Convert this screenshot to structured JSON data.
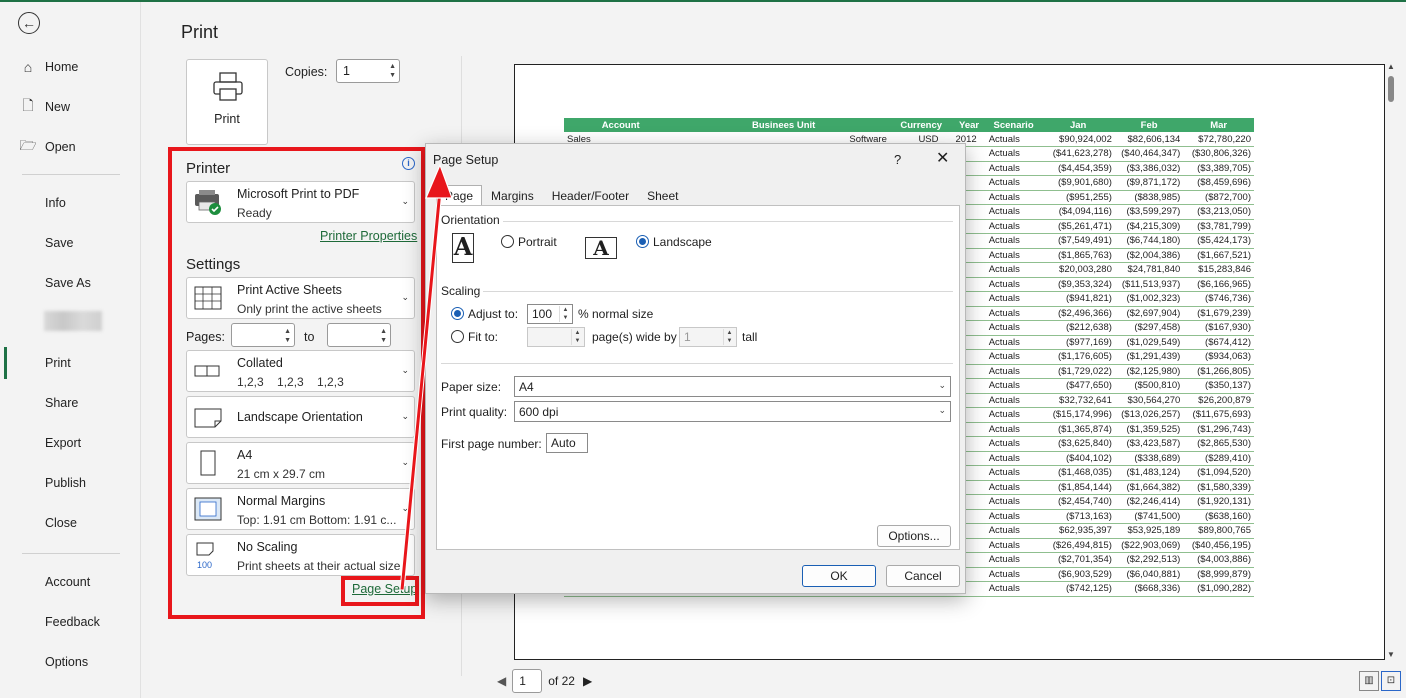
{
  "backstage": {
    "nav_top": [
      "Home",
      "New",
      "Open"
    ],
    "nav_mid": [
      "Info",
      "Save",
      "Save As",
      "Print",
      "Share",
      "Export",
      "Publish",
      "Close"
    ],
    "nav_bottom": [
      "Account",
      "Feedback",
      "Options"
    ],
    "active": "Print"
  },
  "print_panel": {
    "title": "Print",
    "print_button": "Print",
    "copies_label": "Copies:",
    "copies_value": "1",
    "printer_header": "Printer",
    "printer_name": "Microsoft Print to PDF",
    "printer_status": "Ready",
    "printer_properties": "Printer Properties",
    "settings_header": "Settings",
    "settings": [
      {
        "line1": "Print Active Sheets",
        "line2": "Only print the active sheets"
      },
      {
        "line1": "Collated",
        "line2": "1,2,3    1,2,3    1,2,3"
      },
      {
        "line1": "Landscape Orientation",
        "line2": ""
      },
      {
        "line1": "A4",
        "line2": "21 cm x 29.7 cm"
      },
      {
        "line1": "Normal Margins",
        "line2": "Top: 1.91 cm Bottom: 1.91 c..."
      },
      {
        "line1": "No Scaling",
        "line2": "Print sheets at their actual size"
      }
    ],
    "pages_label": "Pages:",
    "to_label": "to",
    "page_setup_link": "Page Setup",
    "no_scaling_badge": "100"
  },
  "preview": {
    "current_page": "1",
    "of_label": "of 22",
    "headers": [
      "Account",
      "Businees Unit",
      "Currency",
      "Year",
      "Scenario",
      "Jan",
      "Feb",
      "Mar"
    ],
    "first_row": [
      "Sales",
      "Software",
      "USD",
      "2012",
      "Actuals",
      "$90,924,002",
      "$82,606,134",
      "$72,780,220"
    ],
    "rows": [
      [
        "($41,623,278)",
        "($40,464,347)",
        "($30,806,326)"
      ],
      [
        "($4,454,359)",
        "($3,386,032)",
        "($3,389,705)"
      ],
      [
        "($9,901,680)",
        "($9,871,172)",
        "($8,459,696)"
      ],
      [
        "($951,255)",
        "($838,985)",
        "($872,700)"
      ],
      [
        "($4,094,116)",
        "($3,599,297)",
        "($3,213,050)"
      ],
      [
        "($5,261,471)",
        "($4,215,309)",
        "($3,781,799)"
      ],
      [
        "($7,549,491)",
        "($6,744,180)",
        "($5,424,173)"
      ],
      [
        "($1,865,763)",
        "($2,004,386)",
        "($1,667,521)"
      ],
      [
        "$20,003,280",
        "$24,781,840",
        "$15,283,846"
      ],
      [
        "($9,353,324)",
        "($11,513,937)",
        "($6,166,965)"
      ],
      [
        "($941,821)",
        "($1,002,323)",
        "($746,736)"
      ],
      [
        "($2,496,366)",
        "($2,697,904)",
        "($1,679,239)"
      ],
      [
        "($212,638)",
        "($297,458)",
        "($167,930)"
      ],
      [
        "($977,169)",
        "($1,029,549)",
        "($674,412)"
      ],
      [
        "($1,176,605)",
        "($1,291,439)",
        "($934,063)"
      ],
      [
        "($1,729,022)",
        "($2,125,980)",
        "($1,266,805)"
      ],
      [
        "($477,650)",
        "($500,810)",
        "($350,137)"
      ],
      [
        "$32,732,641",
        "$30,564,270",
        "$26,200,879"
      ],
      [
        "($15,174,996)",
        "($13,026,257)",
        "($11,675,693)"
      ],
      [
        "($1,365,874)",
        "($1,359,525)",
        "($1,296,743)"
      ],
      [
        "($3,625,840)",
        "($3,423,587)",
        "($2,865,530)"
      ],
      [
        "($404,102)",
        "($338,689)",
        "($289,410)"
      ],
      [
        "($1,468,035)",
        "($1,483,124)",
        "($1,094,520)"
      ],
      [
        "($1,854,144)",
        "($1,664,382)",
        "($1,580,339)"
      ],
      [
        "($2,454,740)",
        "($2,246,414)",
        "($1,920,131)"
      ],
      [
        "($713,163)",
        "($741,500)",
        "($638,160)"
      ],
      [
        "$62,935,397",
        "$53,925,189",
        "$89,800,765"
      ],
      [
        "($26,494,815)",
        "($22,903,069)",
        "($40,456,195)"
      ],
      [
        "($2,701,354)",
        "($2,292,513)",
        "($4,003,886)"
      ],
      [
        "($6,903,529)",
        "($6,040,881)",
        "($8,999,879)"
      ],
      [
        "($742,125)",
        "($668,336)",
        "($1,090,282)"
      ]
    ],
    "scenario": "Actuals"
  },
  "dialog": {
    "title": "Page Setup",
    "help": "?",
    "close": "✕",
    "tabs": [
      "Page",
      "Margins",
      "Header/Footer",
      "Sheet"
    ],
    "orientation_label": "Orientation",
    "portrait": "Portrait",
    "landscape": "Landscape",
    "scaling_label": "Scaling",
    "adjust_to": "Adjust to:",
    "adjust_value": "100",
    "normal_size": "% normal size",
    "fit_to": "Fit to:",
    "fit_wide_value": "",
    "pages_wide_by": "page(s) wide by",
    "fit_tall_value": "1",
    "tall": "tall",
    "paper_size_label": "Paper size:",
    "paper_size_value": "A4",
    "print_quality_label": "Print quality:",
    "print_quality_value": "600 dpi",
    "first_page_label": "First page number:",
    "first_page_value": "Auto",
    "options_button": "Options...",
    "ok_button": "OK",
    "cancel_button": "Cancel"
  },
  "colors": {
    "accent_green": "#1e7145",
    "annotation_red": "#e8161b",
    "header_green": "#3fa76a"
  }
}
